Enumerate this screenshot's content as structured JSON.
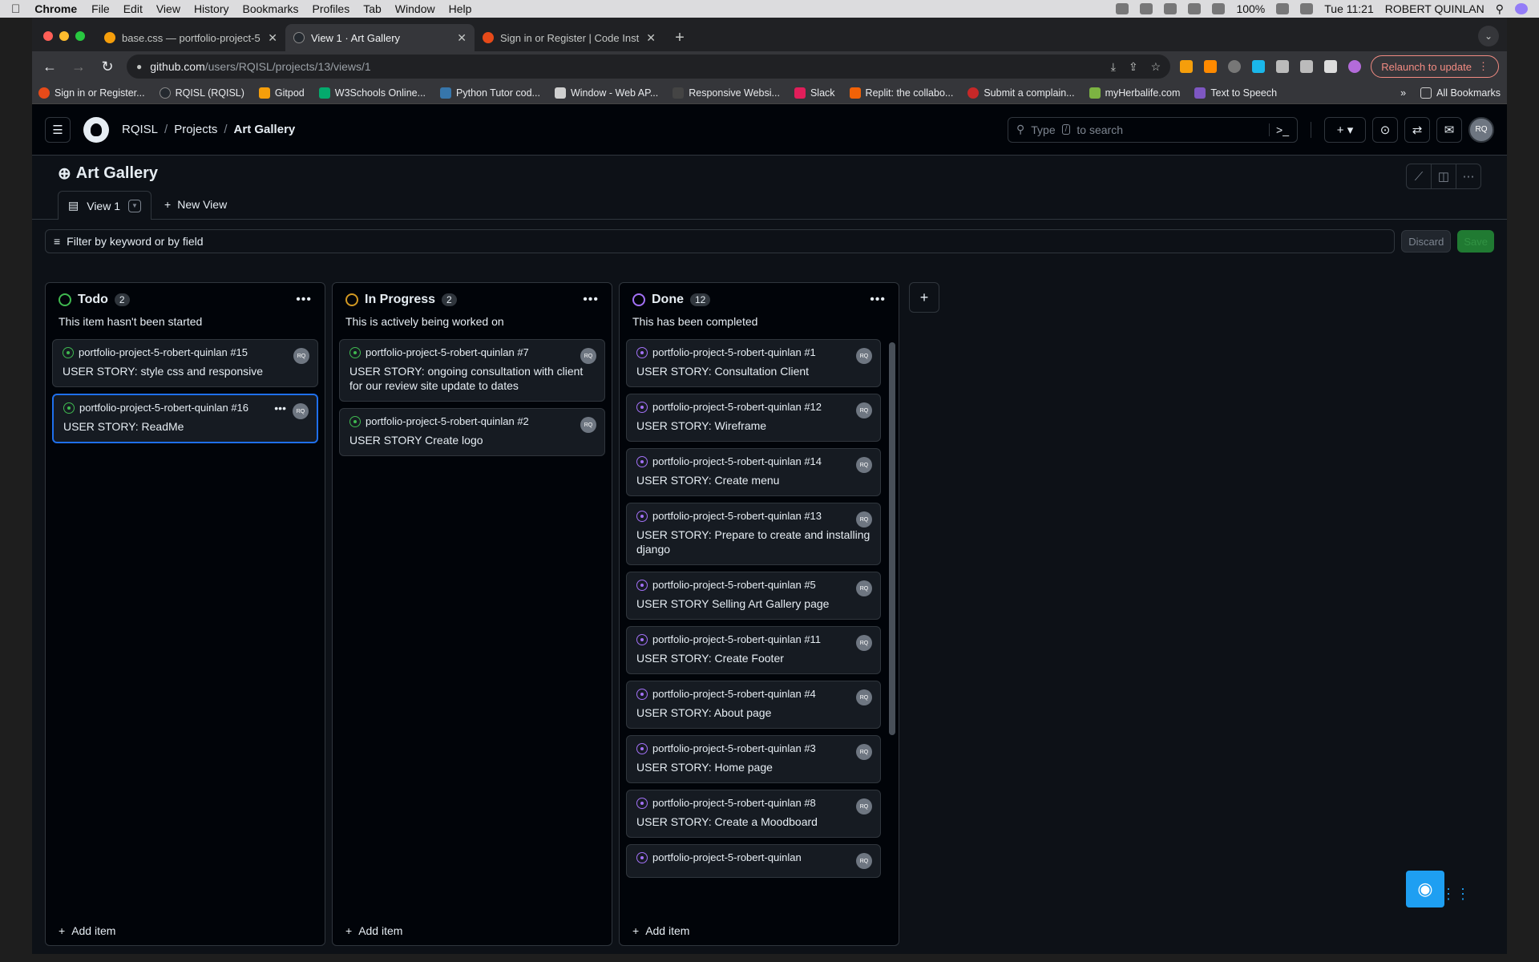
{
  "menubar": {
    "app_name": "Chrome",
    "items": [
      "File",
      "Edit",
      "View",
      "History",
      "Bookmarks",
      "Profiles",
      "Tab",
      "Window",
      "Help"
    ],
    "battery": "100%",
    "clock": "Tue 11:21",
    "user": "ROBERT QUINLAN"
  },
  "tabs": [
    {
      "title": "base.css — portfolio-project-5",
      "favicon_color": "#f59e0b"
    },
    {
      "title": "View 1 · Art Gallery",
      "favicon_color": "#24292f"
    },
    {
      "title": "Sign in or Register | Code Instit",
      "favicon_color": "#e64a19"
    }
  ],
  "omnibox": {
    "host": "github.com",
    "path": "/users/RQISL/projects/13/views/1"
  },
  "relaunch_label": "Relaunch to update",
  "bookmarks": [
    {
      "label": "Sign in or Register...",
      "color": "#e64a19"
    },
    {
      "label": "RQISL (RQISL)",
      "color": "#24292f"
    },
    {
      "label": "Gitpod",
      "color": "#f59e0b"
    },
    {
      "label": "W3Schools Online...",
      "color": "#04aa6d"
    },
    {
      "label": "Python Tutor cod...",
      "color": "#3776ab"
    },
    {
      "label": "Window - Web AP...",
      "color": "#cfcfcf"
    },
    {
      "label": "Responsive Websi...",
      "color": "#444444"
    },
    {
      "label": "Slack",
      "color": "#e01e5a"
    },
    {
      "label": "Replit: the collabo...",
      "color": "#f26207"
    },
    {
      "label": "Submit a complain...",
      "color": "#c62828"
    },
    {
      "label": "myHerbalife.com",
      "color": "#7cb342"
    },
    {
      "label": "Text to Speech",
      "color": "#7e57c2"
    }
  ],
  "bookmarks_more": "»",
  "all_bookmarks": "All Bookmarks",
  "gh": {
    "breadcrumb": [
      "RQISL",
      "Projects",
      "Art Gallery"
    ],
    "search_prefix": "Type",
    "search_kbd": "/",
    "search_suffix": "to search"
  },
  "project": {
    "title": "Art Gallery",
    "view_tab": "View 1",
    "new_view": "New View",
    "filter_placeholder": "Filter by keyword or by field",
    "discard": "Discard",
    "save": "Save",
    "add_item": "Add item"
  },
  "columns": [
    {
      "name": "Todo",
      "count": "2",
      "status_color": "#3fb950",
      "description": "This item hasn't been started",
      "cards": [
        {
          "repo": "portfolio-project-5-robert-quinlan #15",
          "title": "USER STORY: style css and responsive",
          "state": "open"
        },
        {
          "repo": "portfolio-project-5-robert-quinlan #16",
          "title": "USER STORY: ReadMe",
          "state": "open",
          "selected": true
        }
      ]
    },
    {
      "name": "In Progress",
      "count": "2",
      "status_color": "#d29922",
      "description": "This is actively being worked on",
      "cards": [
        {
          "repo": "portfolio-project-5-robert-quinlan #7",
          "title": "USER STORY: ongoing consultation with client for our review site update to dates",
          "state": "open"
        },
        {
          "repo": "portfolio-project-5-robert-quinlan #2",
          "title": "USER STORY Create logo",
          "state": "open"
        }
      ]
    },
    {
      "name": "Done",
      "count": "12",
      "status_color": "#a371f7",
      "description": "This has been completed",
      "cards": [
        {
          "repo": "portfolio-project-5-robert-quinlan #1",
          "title": "USER STORY: Consultation Client",
          "state": "closed"
        },
        {
          "repo": "portfolio-project-5-robert-quinlan #12",
          "title": "USER STORY: Wireframe",
          "state": "closed"
        },
        {
          "repo": "portfolio-project-5-robert-quinlan #14",
          "title": "USER STORY: Create menu",
          "state": "closed"
        },
        {
          "repo": "portfolio-project-5-robert-quinlan #13",
          "title": "USER STORY: Prepare to create and installing django",
          "state": "closed"
        },
        {
          "repo": "portfolio-project-5-robert-quinlan #5",
          "title": "USER STORY Selling Art Gallery page",
          "state": "closed"
        },
        {
          "repo": "portfolio-project-5-robert-quinlan #11",
          "title": "USER STORY: Create Footer",
          "state": "closed"
        },
        {
          "repo": "portfolio-project-5-robert-quinlan #4",
          "title": "USER STORY: About page",
          "state": "closed"
        },
        {
          "repo": "portfolio-project-5-robert-quinlan #3",
          "title": "USER STORY: Home page",
          "state": "closed"
        },
        {
          "repo": "portfolio-project-5-robert-quinlan #8",
          "title": "USER STORY: Create a Moodboard",
          "state": "closed"
        },
        {
          "repo": "portfolio-project-5-robert-quinlan",
          "title": "",
          "state": "closed"
        }
      ]
    }
  ]
}
